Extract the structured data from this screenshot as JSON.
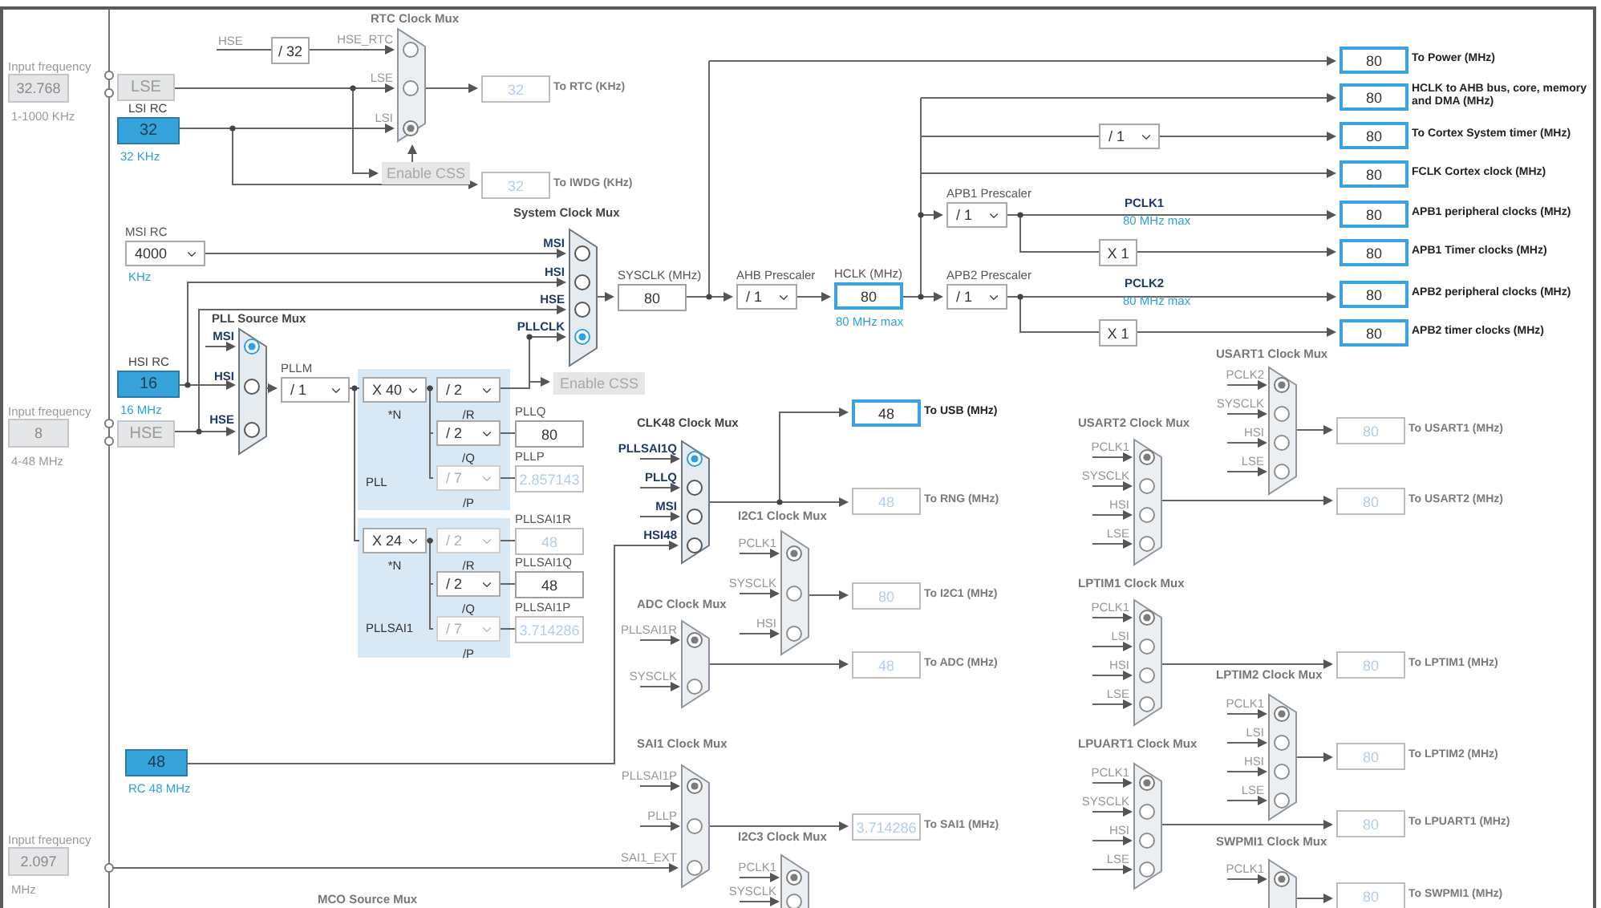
{
  "input_frequencies": [
    {
      "label": "Input frequency",
      "value": "32.768",
      "range": "1-1000 KHz"
    },
    {
      "label": "Input frequency",
      "value": "8",
      "range": "4-48 MHz"
    },
    {
      "label": "Input frequency",
      "value": "2.097",
      "range": "MHz"
    }
  ],
  "oscillators": [
    {
      "value": "LSE",
      "enabled": false
    },
    {
      "title": "LSI RC",
      "value": "32",
      "note": "32 KHz",
      "enabled": true
    },
    {
      "title": "HSI RC",
      "value": "16",
      "note": "16 MHz",
      "enabled": true
    },
    {
      "value": "HSE",
      "enabled": false
    },
    {
      "value": "48",
      "note": "RC 48 MHz",
      "enabled": true
    }
  ],
  "prescalers": [
    {
      "title": "MSI RC",
      "value": "4000",
      "unit": "KHz",
      "enabled": true
    },
    {
      "title": "PLLM",
      "value": "/ 1",
      "enabled": true
    },
    {
      "value": "X 40",
      "caption": "*N",
      "enabled": true
    },
    {
      "value": "/ 2",
      "caption": "/R",
      "enabled": true
    },
    {
      "value": "/ 2",
      "caption": "/Q",
      "enabled": true
    },
    {
      "value": "/ 7",
      "caption": "/P",
      "enabled": false
    },
    {
      "value": "X 24",
      "caption": "*N",
      "enabled": true
    },
    {
      "value": "/ 2",
      "caption": "/R",
      "enabled": false
    },
    {
      "value": "/ 2",
      "caption": "/Q",
      "enabled": true
    },
    {
      "value": "/ 7",
      "caption": "/P",
      "enabled": false
    },
    {
      "title": "AHB Prescaler",
      "value": "/ 1",
      "enabled": true
    },
    {
      "value": "/ 1",
      "enabled": true
    },
    {
      "title": "APB1 Prescaler",
      "value": "/ 1",
      "enabled": true
    },
    {
      "title": "APB2 Prescaler",
      "value": "/ 1",
      "enabled": true
    }
  ],
  "fixed_dividers": [
    {
      "value": "/ 32"
    },
    {
      "value": "X 1"
    },
    {
      "value": "X 1"
    }
  ],
  "pll_groups": [
    {
      "name": "PLL"
    },
    {
      "name": "PLLSAI1"
    }
  ],
  "muxes": [
    {
      "title": "RTC Clock Mux",
      "enabled": false,
      "inputs": [
        {
          "label": "HSE_RTC",
          "selected": false
        },
        {
          "label": "LSE",
          "selected": false
        },
        {
          "label": "LSI",
          "selected": true
        }
      ]
    },
    {
      "title": "System Clock Mux",
      "enabled": true,
      "inputs": [
        {
          "label": "MSI",
          "selected": false
        },
        {
          "label": "HSI",
          "selected": false
        },
        {
          "label": "HSE",
          "selected": false
        },
        {
          "label": "PLLCLK",
          "selected": true
        }
      ]
    },
    {
      "title": "PLL Source Mux",
      "enabled": true,
      "inputs": [
        {
          "label": "MSI",
          "selected": true
        },
        {
          "label": "HSI",
          "selected": false
        },
        {
          "label": "HSE",
          "selected": false
        }
      ]
    },
    {
      "title": "CLK48 Clock Mux",
      "enabled": true,
      "inputs": [
        {
          "label": "PLLSAI1Q",
          "selected": true
        },
        {
          "label": "PLLQ",
          "selected": false
        },
        {
          "label": "MSI",
          "selected": false
        },
        {
          "label": "HSI48",
          "selected": false
        }
      ]
    },
    {
      "title": "I2C1 Clock Mux",
      "enabled": false,
      "inputs": [
        {
          "label": "PCLK1",
          "selected": true
        },
        {
          "label": "SYSCLK",
          "selected": false
        },
        {
          "label": "HSI",
          "selected": false
        }
      ]
    },
    {
      "title": "ADC Clock Mux",
      "enabled": false,
      "inputs": [
        {
          "label": "PLLSAI1R",
          "selected": true
        },
        {
          "label": "SYSCLK",
          "selected": false
        }
      ]
    },
    {
      "title": "SAI1 Clock Mux",
      "enabled": false,
      "inputs": [
        {
          "label": "PLLSAI1P",
          "selected": true
        },
        {
          "label": "PLLP",
          "selected": false
        },
        {
          "label": "SAI1_EXT",
          "selected": false
        }
      ]
    },
    {
      "title": "I2C3 Clock Mux",
      "enabled": false,
      "inputs": [
        {
          "label": "PCLK1",
          "selected": true
        },
        {
          "label": "SYSCLK",
          "selected": false
        }
      ]
    },
    {
      "title": "USART1 Clock Mux",
      "enabled": false,
      "inputs": [
        {
          "label": "PCLK2",
          "selected": true
        },
        {
          "label": "SYSCLK",
          "selected": false
        },
        {
          "label": "HSI",
          "selected": false
        },
        {
          "label": "LSE",
          "selected": false
        }
      ]
    },
    {
      "title": "USART2 Clock Mux",
      "enabled": false,
      "inputs": [
        {
          "label": "PCLK1",
          "selected": true
        },
        {
          "label": "SYSCLK",
          "selected": false
        },
        {
          "label": "HSI",
          "selected": false
        },
        {
          "label": "LSE",
          "selected": false
        }
      ]
    },
    {
      "title": "LPTIM1 Clock Mux",
      "enabled": false,
      "inputs": [
        {
          "label": "PCLK1",
          "selected": true
        },
        {
          "label": "LSI",
          "selected": false
        },
        {
          "label": "HSI",
          "selected": false
        },
        {
          "label": "LSE",
          "selected": false
        }
      ]
    },
    {
      "title": "LPTIM2 Clock Mux",
      "enabled": false,
      "inputs": [
        {
          "label": "PCLK1",
          "selected": true
        },
        {
          "label": "LSI",
          "selected": false
        },
        {
          "label": "HSI",
          "selected": false
        },
        {
          "label": "LSE",
          "selected": false
        }
      ]
    },
    {
      "title": "LPUART1 Clock Mux",
      "enabled": false,
      "inputs": [
        {
          "label": "PCLK1",
          "selected": true
        },
        {
          "label": "SYSCLK",
          "selected": false
        },
        {
          "label": "HSI",
          "selected": false
        },
        {
          "label": "LSE",
          "selected": false
        }
      ]
    },
    {
      "title": "SWPMI1 Clock Mux",
      "enabled": false,
      "inputs": [
        {
          "label": "PCLK1",
          "selected": true
        }
      ]
    },
    {
      "title": "MCO Source Mux",
      "enabled": false
    }
  ],
  "outputs": [
    {
      "value": "32",
      "label": "To RTC (KHz)",
      "enabled": false,
      "highlighted": false
    },
    {
      "value": "32",
      "label": "To IWDG (KHz)",
      "enabled": false,
      "highlighted": false
    },
    {
      "title": "SYSCLK (MHz)",
      "value": "80",
      "enabled": true,
      "highlighted": false
    },
    {
      "title": "HCLK (MHz)",
      "value": "80",
      "note": "80 MHz max",
      "enabled": true,
      "highlighted": true
    },
    {
      "title": "PLLQ",
      "value": "80",
      "enabled": true,
      "highlighted": false
    },
    {
      "title": "PLLP",
      "value": "2.857143",
      "enabled": false,
      "highlighted": false
    },
    {
      "title": "PLLSAI1R",
      "value": "48",
      "enabled": false,
      "highlighted": false
    },
    {
      "title": "PLLSAI1Q",
      "value": "48",
      "enabled": true,
      "highlighted": false
    },
    {
      "title": "PLLSAI1P",
      "value": "3.714286",
      "enabled": false,
      "highlighted": false
    },
    {
      "value": "80",
      "label": "To Power (MHz)",
      "enabled": true,
      "highlighted": true
    },
    {
      "value": "80",
      "label": "HCLK to AHB bus, core, memory and DMA (MHz)",
      "enabled": true,
      "highlighted": true
    },
    {
      "value": "80",
      "label": "To Cortex System timer (MHz)",
      "enabled": true,
      "highlighted": true
    },
    {
      "value": "80",
      "label": "FCLK Cortex clock (MHz)",
      "enabled": true,
      "highlighted": true
    },
    {
      "value": "80",
      "label": "APB1 peripheral clocks (MHz)",
      "enabled": true,
      "highlighted": true
    },
    {
      "value": "80",
      "label": "APB1 Timer clocks (MHz)",
      "enabled": true,
      "highlighted": true
    },
    {
      "value": "80",
      "label": "APB2 peripheral clocks (MHz)",
      "enabled": true,
      "highlighted": true
    },
    {
      "value": "80",
      "label": "APB2 timer clocks (MHz)",
      "enabled": true,
      "highlighted": true
    },
    {
      "value": "48",
      "label": "To USB (MHz)",
      "enabled": true,
      "highlighted": true
    },
    {
      "value": "48",
      "label": "To RNG (MHz)",
      "enabled": false,
      "highlighted": false
    },
    {
      "value": "80",
      "label": "To I2C1 (MHz)",
      "enabled": false,
      "highlighted": false
    },
    {
      "value": "48",
      "label": "To ADC (MHz)",
      "enabled": false,
      "highlighted": false
    },
    {
      "value": "3.714286",
      "label": "To SAI1 (MHz)",
      "enabled": false,
      "highlighted": false
    },
    {
      "value": "80",
      "label": "To USART1 (MHz)",
      "enabled": false,
      "highlighted": false
    },
    {
      "value": "80",
      "label": "To USART2 (MHz)",
      "enabled": false,
      "highlighted": false
    },
    {
      "value": "80",
      "label": "To LPTIM1 (MHz)",
      "enabled": false,
      "highlighted": false
    },
    {
      "value": "80",
      "label": "To LPTIM2 (MHz)",
      "enabled": false,
      "highlighted": false
    },
    {
      "value": "80",
      "label": "To LPUART1 (MHz)",
      "enabled": false,
      "highlighted": false
    },
    {
      "value": "80",
      "label": "To SWPMI1 (MHz)",
      "enabled": false,
      "highlighted": false
    }
  ],
  "buttons": [
    {
      "label": "Enable CSS",
      "enabled": false
    },
    {
      "label": "Enable CSS",
      "enabled": false
    }
  ],
  "signal_labels": [
    {
      "text": "HSE"
    },
    {
      "text": "PCLK1",
      "note": "80 MHz max"
    },
    {
      "text": "PCLK2",
      "note": "80 MHz max"
    }
  ]
}
